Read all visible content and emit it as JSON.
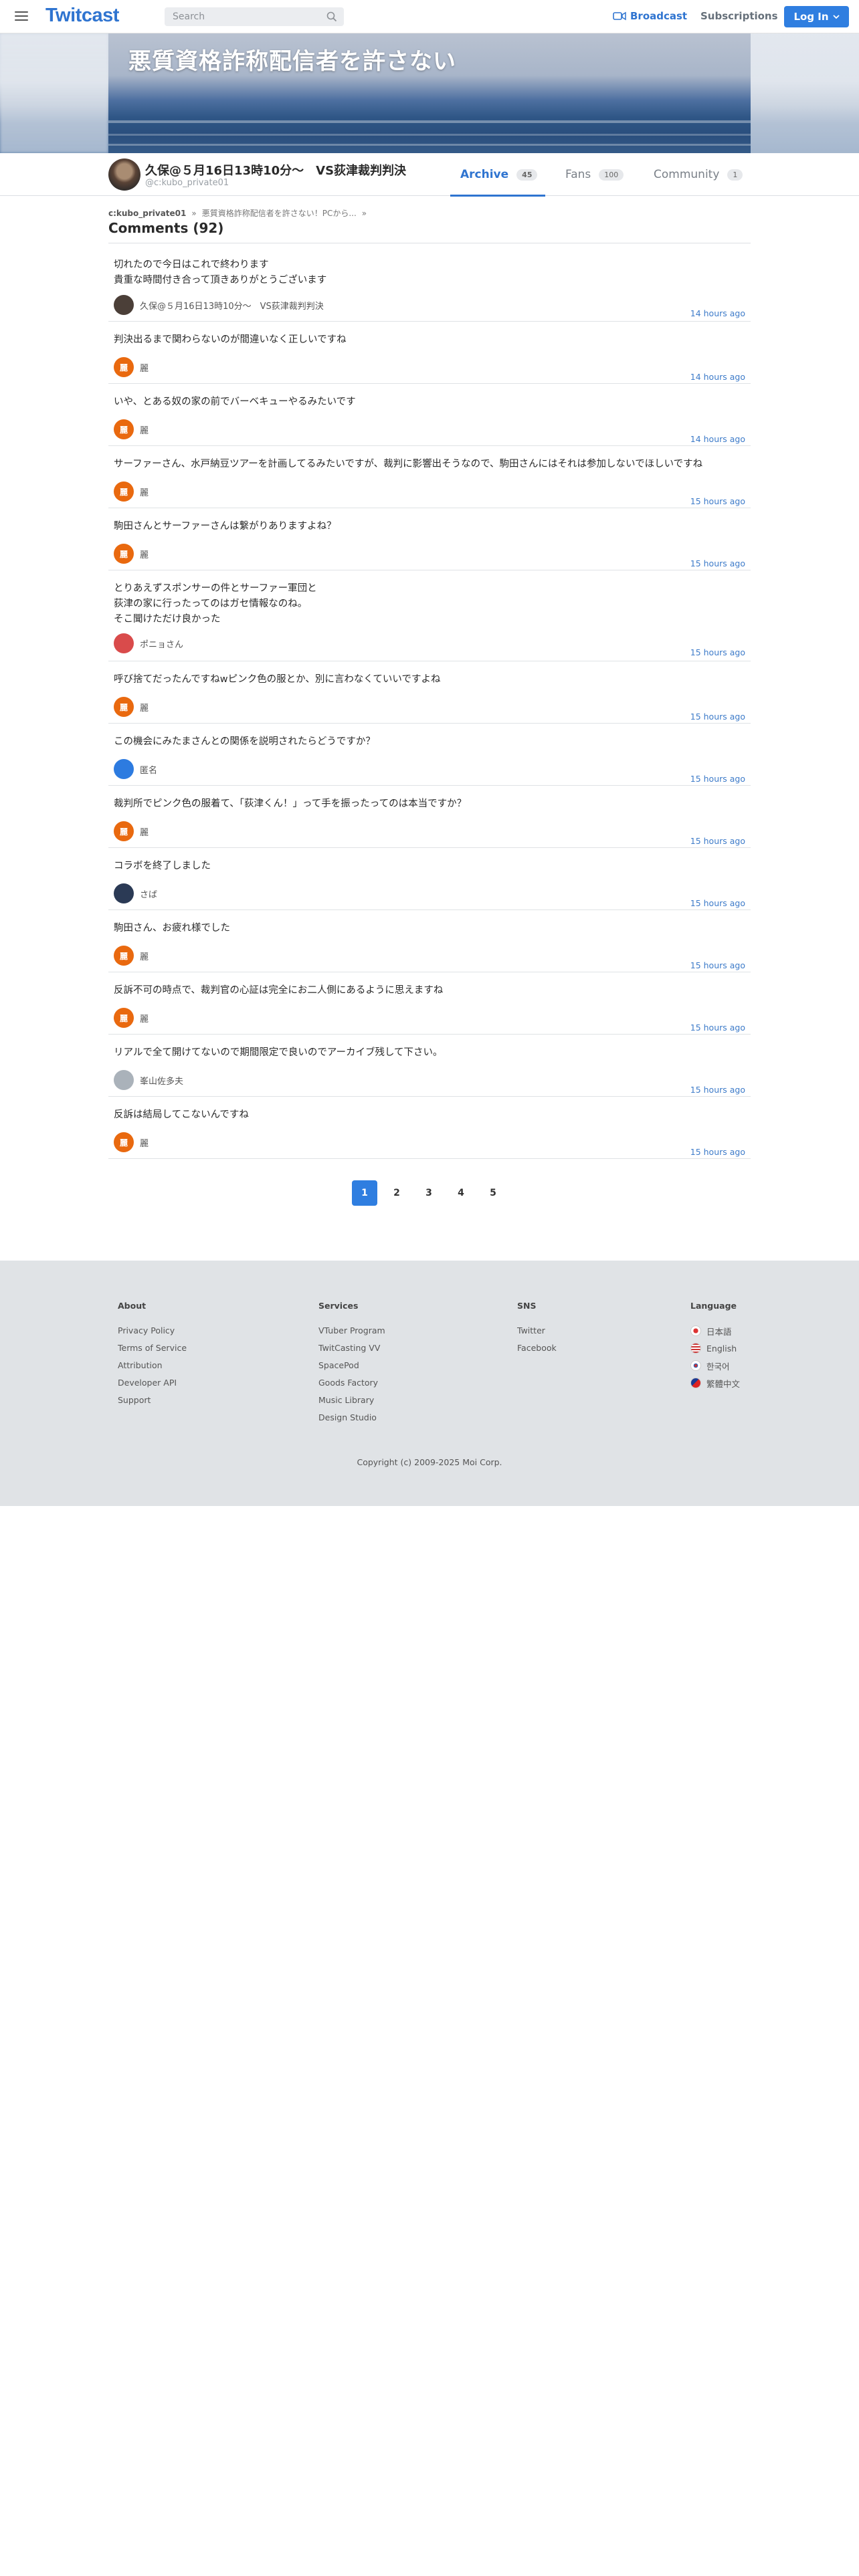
{
  "header": {
    "logo": "Twitcast",
    "search_placeholder": "Search",
    "broadcast": "Broadcast",
    "subscriptions": "Subscriptions",
    "login": "Log In"
  },
  "banner": {
    "title": "悪質資格詐称配信者を許さない"
  },
  "profile": {
    "name": "久保@５月16日13時10分〜　VS荻津裁判判決",
    "id": "@c:kubo_private01",
    "tabs": [
      {
        "label": "Archive",
        "count": "45"
      },
      {
        "label": "Fans",
        "count": "100"
      },
      {
        "label": "Community",
        "count": "1"
      }
    ]
  },
  "breadcrumb": {
    "user": "c:kubo_private01",
    "sep1": "»",
    "title": "悪質資格詐称配信者を許さない！PCから...",
    "sep2": "»"
  },
  "comments_heading": "Comments (92)",
  "comments": [
    {
      "text": "切れたので今日はこれで終わります\n貴重な時間付き合って頂きありがとうございます",
      "author": "久保@５月16日13時10分〜　VS荻津裁判判決",
      "time": "14 hours ago",
      "avatar_color": "#4b3f38",
      "avatar_char": ""
    },
    {
      "text": "判決出るまで関わらないのが間違いなく正しいですね",
      "author": "麗",
      "time": "14 hours ago",
      "avatar_color": "#e9690f",
      "avatar_char": "麗"
    },
    {
      "text": "いや、とある奴の家の前でバーベキューやるみたいです",
      "author": "麗",
      "time": "14 hours ago",
      "avatar_color": "#e9690f",
      "avatar_char": "麗"
    },
    {
      "text": "サーファーさん、水戸納豆ツアーを計画してるみたいですが、裁判に影響出そうなので、駒田さんにはそれは参加しないでほしいですね",
      "author": "麗",
      "time": "15 hours ago",
      "avatar_color": "#e9690f",
      "avatar_char": "麗"
    },
    {
      "text": "駒田さんとサーファーさんは繋がりありますよね？",
      "author": "麗",
      "time": "15 hours ago",
      "avatar_color": "#e9690f",
      "avatar_char": "麗"
    },
    {
      "text": "とりあえずスポンサーの件とサーファー軍団と\n荻津の家に行ったってのはガセ情報なのね。\nそこ聞けただけ良かった",
      "author": "ポニョさん",
      "time": "15 hours ago",
      "avatar_color": "#d94b4b",
      "avatar_char": ""
    },
    {
      "text": "呼び捨てだったんですねwピンク色の服とか、別に言わなくていいですよね",
      "author": "麗",
      "time": "15 hours ago",
      "avatar_color": "#e9690f",
      "avatar_char": "麗"
    },
    {
      "text": "この機会にみたまさんとの関係を説明されたらどうですか？",
      "author": "匿名",
      "time": "15 hours ago",
      "avatar_color": "#2d7be0",
      "avatar_char": ""
    },
    {
      "text": "裁判所でピンク色の服着て、「荻津くん！」って手を振ったってのは本当ですか？",
      "author": "麗",
      "time": "15 hours ago",
      "avatar_color": "#e9690f",
      "avatar_char": "麗"
    },
    {
      "text": "コラボを終了しました",
      "author": "さば",
      "time": "15 hours ago",
      "avatar_color": "#2b3a55",
      "avatar_char": ""
    },
    {
      "text": "駒田さん、お疲れ様でした",
      "author": "麗",
      "time": "15 hours ago",
      "avatar_color": "#e9690f",
      "avatar_char": "麗"
    },
    {
      "text": "反訴不可の時点で、裁判官の心証は完全にお二人側にあるように思えますね",
      "author": "麗",
      "time": "15 hours ago",
      "avatar_color": "#e9690f",
      "avatar_char": "麗"
    },
    {
      "text": "リアルで全て開けてないので期間限定で良いのでアーカイブ残して下さい。",
      "author": "峯山佐多夫",
      "time": "15 hours ago",
      "avatar_color": "#aab2ba",
      "avatar_char": ""
    },
    {
      "text": "反訴は結局してこないんですね",
      "author": "麗",
      "time": "15 hours ago",
      "avatar_color": "#e9690f",
      "avatar_char": "麗"
    }
  ],
  "pagination": [
    "1",
    "2",
    "3",
    "4",
    "5"
  ],
  "footer": {
    "about": {
      "heading": "About",
      "links": [
        "Privacy Policy",
        "Terms of Service",
        "Attribution",
        "Developer API",
        "Support"
      ]
    },
    "services": {
      "heading": "Services",
      "links": [
        "VTuber Program",
        "TwitCasting VV",
        "SpacePod",
        "Goods Factory",
        "Music Library",
        "Design Studio"
      ]
    },
    "sns": {
      "heading": "SNS",
      "links": [
        "Twitter",
        "Facebook"
      ]
    },
    "language": {
      "heading": "Language",
      "links": [
        "日本語",
        "English",
        "한국어",
        "繁體中文"
      ]
    },
    "copyright": "Copyright (c) 2009-2025 Moi Corp."
  },
  "colors": {
    "accent": "#2f74d0",
    "login_bg": "#2f7ee0",
    "timestamp": "#3d7bc9",
    "footer_bg": "#e0e3e6"
  }
}
